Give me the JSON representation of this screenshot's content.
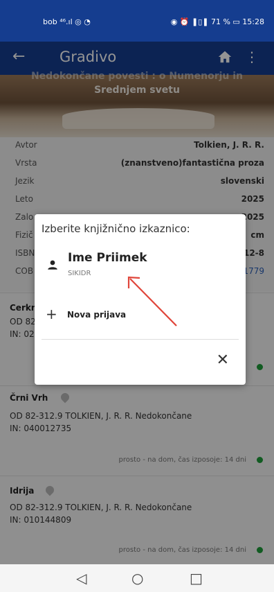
{
  "status_bar": {
    "left_text": "bob ⁴⁶.ıl  ◎  ◔",
    "right_text": "◉ ⏰ ❚▯❚ 71 % ▭ 15:28"
  },
  "app_bar": {
    "title": "Gradivo"
  },
  "cover": {
    "title_line1": "Nedokončane povesti : o Numenorju in",
    "title_line2": "Srednjem svetu"
  },
  "details": [
    {
      "label": "Avtor",
      "value": "Tolkien, J. R. R."
    },
    {
      "label": "Vrsta",
      "value": "(znanstveno)fantastična proza"
    },
    {
      "label": "Jezik",
      "value": "slovenski"
    },
    {
      "label": "Leto",
      "value": "2025"
    },
    {
      "label": "Zalo",
      "value": "2025"
    },
    {
      "label": "Fizič",
      "value": "cm"
    },
    {
      "label": "ISBN",
      "value": "12-8"
    },
    {
      "label": "COB",
      "value": "1779"
    }
  ],
  "cards": [
    {
      "library": "Cerkn",
      "line1": "OD 82",
      "line2": "IN: 02",
      "status": ""
    },
    {
      "library": "Črni Vrh",
      "line1": "OD 82-312.9 TOLKIEN, J. R. R. Nedokončane",
      "line2": "IN: 040012735",
      "status": "prosto - na dom, čas izposoje: 14 dni"
    },
    {
      "library": "Idrija",
      "line1": "OD 82-312.9 TOLKIEN, J. R. R. Nedokončane",
      "line2": "IN: 010144809",
      "status": "prosto - na dom, čas izposoje: 14 dni"
    }
  ],
  "dialog": {
    "title": "Izberite knjižnično izkaznico:",
    "user_name": "Ime Priimek",
    "user_sub": "SIKIDR",
    "new_login": "Nova prijava"
  },
  "colors": {
    "primary": "#153d8f",
    "available_dot": "#1e9e3a",
    "annotation_arrow": "#e0453a"
  }
}
